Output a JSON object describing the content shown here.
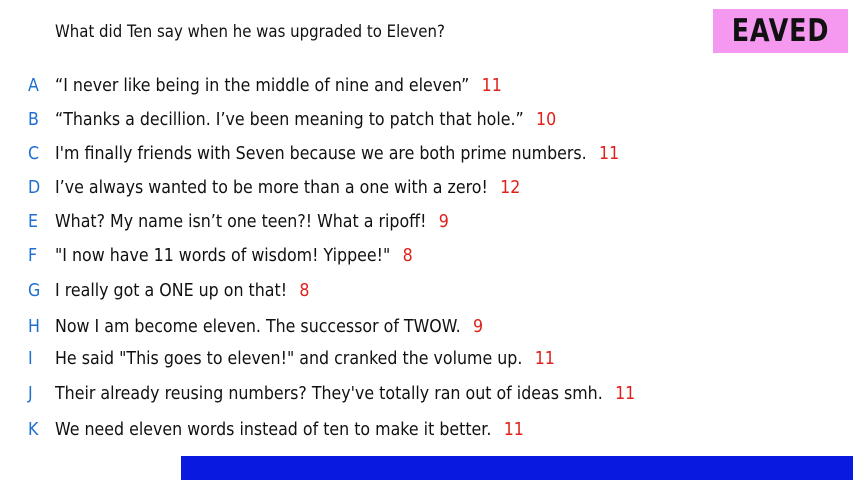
{
  "question": "What did Ten say when he was upgraded to Eleven?",
  "logo": "EAVED",
  "colors": {
    "letter": "#1f6fd1",
    "count": "#e0201b",
    "logo_bg": "#f598f0",
    "bottom_bar": "#0a19e0"
  },
  "responses": [
    {
      "letter": "A",
      "text": "“I never like being in the middle of nine and eleven”",
      "count": "11"
    },
    {
      "letter": "B",
      "text": "“Thanks a decillion. I’ve been meaning to patch that hole.”",
      "count": "10"
    },
    {
      "letter": "C",
      "text": "I'm finally friends with Seven because we are both prime numbers.",
      "count": "11"
    },
    {
      "letter": "D",
      "text": "I’ve always wanted to be more than a one with a zero!",
      "count": "12"
    },
    {
      "letter": "E",
      "text": "What? My name isn’t one teen?! What a ripoff!",
      "count": "9"
    },
    {
      "letter": "F",
      "text": "\"I now have 11 words of wisdom! Yippee!\"",
      "count": "8"
    },
    {
      "letter": "G",
      "text": "I really got a ONE up on that!",
      "count": "8"
    },
    {
      "letter": "H",
      "text": "Now I am become eleven. The successor of TWOW.",
      "count": "9"
    },
    {
      "letter": "I",
      "text": "He said \"This goes to eleven!\" and cranked the volume up.",
      "count": "11"
    },
    {
      "letter": "J",
      "text": "Their already reusing numbers? They've totally ran out of ideas smh.",
      "count": "11"
    },
    {
      "letter": "K",
      "text": "We need eleven words instead of ten to make it better.",
      "count": "11"
    }
  ]
}
